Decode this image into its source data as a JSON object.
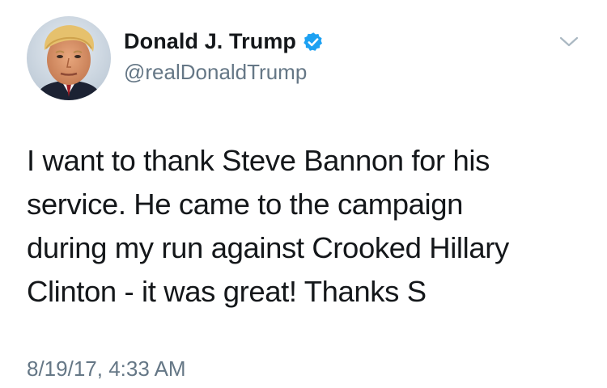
{
  "author": {
    "display_name": "Donald J. Trump",
    "handle": "@realDonaldTrump",
    "verified": true,
    "avatar_icon": "profile-photo"
  },
  "tweet": {
    "lines": [
      "I want to thank Steve Bannon for his",
      "service. He came to the campaign",
      "during my run against Crooked Hillary",
      "Clinton - it was great! Thanks S"
    ],
    "timestamp": "8/19/17, 4:33 AM"
  },
  "icons": {
    "verified": "verified-badge-icon",
    "menu": "chevron-down-icon"
  },
  "colors": {
    "text": "#14171a",
    "secondary": "#657786",
    "verified_blue": "#1da1f2",
    "caret": "#aab8c2"
  }
}
